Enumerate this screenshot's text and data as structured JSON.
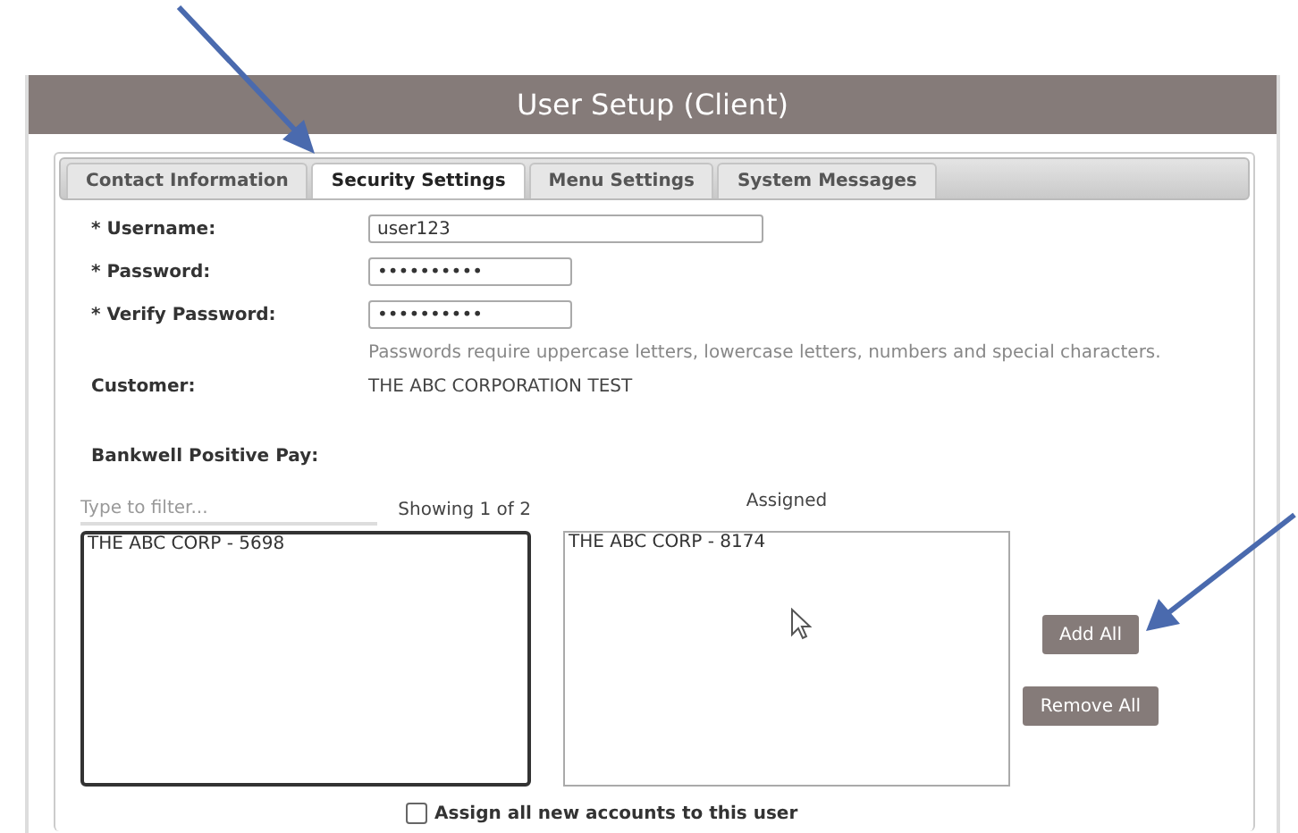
{
  "window": {
    "title": "User Setup (Client)"
  },
  "tabs": [
    {
      "label": "Contact Information",
      "selected": false
    },
    {
      "label": "Security Settings",
      "selected": true
    },
    {
      "label": "Menu Settings",
      "selected": false
    },
    {
      "label": "System Messages",
      "selected": false
    }
  ],
  "fields": [
    {
      "label": "* Username:",
      "kind": "text",
      "value": "user123"
    },
    {
      "label": "* Password:",
      "kind": "password",
      "value": "••••••••••"
    },
    {
      "label": "* Verify Password:",
      "kind": "password",
      "value": "••••••••••"
    }
  ],
  "password_hint": "Passwords require uppercase letters, lowercase letters, numbers and special characters.",
  "customer": {
    "label": "Customer:",
    "value": "THE ABC CORPORATION TEST"
  },
  "section_label": "Bankwell Positive Pay:",
  "available": {
    "filter_placeholder": "Type to filter...",
    "count": "Showing 1 of 2",
    "items": [
      "THE ABC CORP - 5698"
    ]
  },
  "assigned": {
    "heading": "Assigned",
    "items": [
      "THE ABC CORP - 8174"
    ]
  },
  "buttons": [
    "Add All",
    "Remove All"
  ],
  "assign_all": {
    "label": "Assign all new accounts to this user",
    "checked": false
  }
}
